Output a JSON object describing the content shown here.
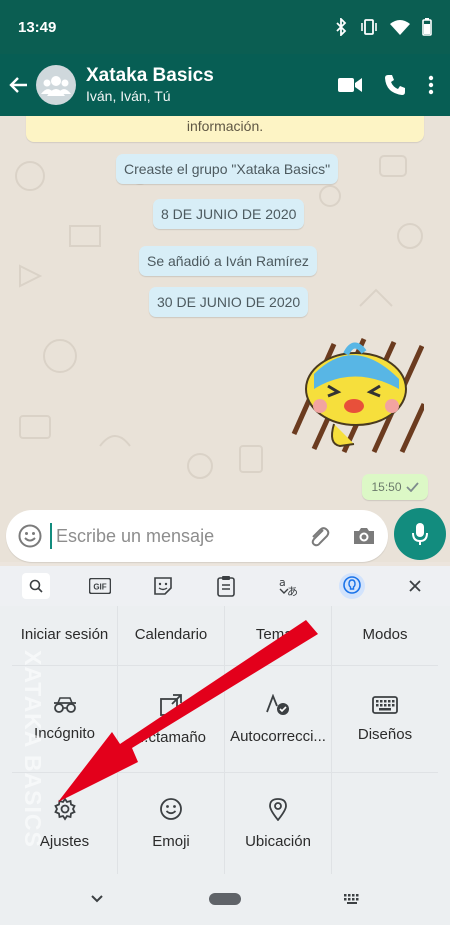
{
  "status_bar": {
    "time": "13:49"
  },
  "header": {
    "title": "Xataka Basics",
    "subtitle": "Iván, Iván, Tú"
  },
  "chat": {
    "notice": "información.",
    "system_messages": [
      "Creaste el grupo \"Xataka Basics\"",
      "8 DE JUNIO DE 2020",
      "Se añadió a Iván Ramírez",
      "30 DE JUNIO DE 2020"
    ],
    "sticker_time": "15:50"
  },
  "input": {
    "placeholder": "Escribe un mensaje"
  },
  "keyboard": {
    "toolbar": [
      "search-icon",
      "gif-icon",
      "sticker-icon",
      "clipboard-icon",
      "translate-icon",
      "lightbulb-icon",
      "close-icon"
    ],
    "gif_label": "GIF",
    "menu": [
      {
        "label": "Iniciar sesión",
        "icon": "none"
      },
      {
        "label": "Calendario",
        "icon": "none"
      },
      {
        "label": "Temas",
        "icon": "none"
      },
      {
        "label": "Modos",
        "icon": "none"
      },
      {
        "label": "Incógnito",
        "icon": "incognito-icon"
      },
      {
        "label": "...ctamaño",
        "icon": "resize-icon"
      },
      {
        "label": "Autocorrecci...",
        "icon": "autocorrect-icon"
      },
      {
        "label": "Diseños",
        "icon": "keyboard-icon"
      },
      {
        "label": "Ajustes",
        "icon": "settings-gear-icon"
      },
      {
        "label": "Emoji",
        "icon": "emoji-icon"
      },
      {
        "label": "Ubicación",
        "icon": "location-pin-icon"
      }
    ]
  },
  "watermark": "XATAKA BASICS",
  "colors": {
    "header": "#075e54",
    "accent": "#128c7e",
    "arrow": "#e3001b"
  }
}
